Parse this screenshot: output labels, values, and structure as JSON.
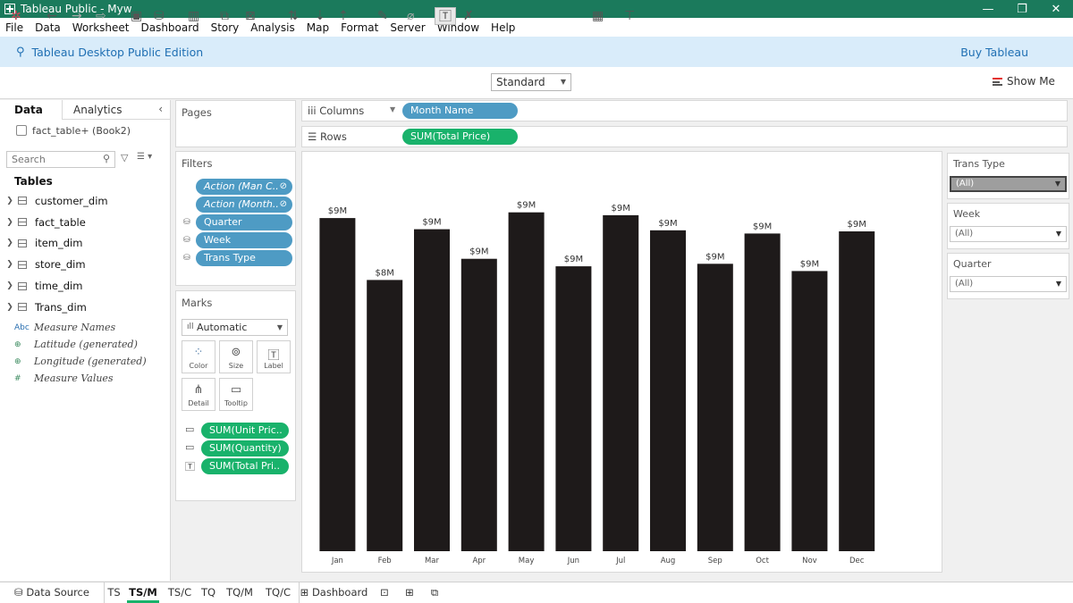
{
  "window": {
    "title": "Tableau Public - Myw",
    "controls": [
      "—",
      "❐",
      "✕"
    ]
  },
  "menu": [
    "File",
    "Data",
    "Worksheet",
    "Dashboard",
    "Story",
    "Analysis",
    "Map",
    "Format",
    "Server",
    "Window",
    "Help"
  ],
  "edition": {
    "title": "Tableau Desktop Public Edition",
    "buy": "Buy Tableau"
  },
  "toolbar": {
    "fit_select": "Standard",
    "show_me": "Show Me"
  },
  "data_pane": {
    "tabs": [
      "Data",
      "Analytics"
    ],
    "datasource": "fact_table+ (Book2)",
    "search_placeholder": "Search",
    "tables_label": "Tables",
    "tables": [
      "customer_dim",
      "fact_table",
      "item_dim",
      "store_dim",
      "time_dim",
      "Trans_dim"
    ],
    "fields": [
      {
        "icon": "Abc",
        "name": "Measure Names"
      },
      {
        "icon": "⊕",
        "name": "Latitude (generated)"
      },
      {
        "icon": "⊕",
        "name": "Longitude (generated)"
      },
      {
        "icon": "#",
        "name": "Measure Values"
      }
    ]
  },
  "pages": {
    "title": "Pages"
  },
  "filters": {
    "title": "Filters",
    "pills": [
      {
        "label": "Action (Man C..",
        "style": "italic"
      },
      {
        "label": "Action (Month..",
        "style": "italic"
      },
      {
        "label": "Quarter",
        "style": "normal"
      },
      {
        "label": "Week",
        "style": "normal"
      },
      {
        "label": "Trans Type",
        "style": "normal"
      }
    ]
  },
  "marks": {
    "title": "Marks",
    "type": "Automatic",
    "buttons": [
      "Color",
      "Size",
      "Label",
      "Detail",
      "Tooltip"
    ],
    "fields": [
      {
        "icon": "tooltip",
        "label": "SUM(Unit Pric.."
      },
      {
        "icon": "tooltip",
        "label": "SUM(Quantity)"
      },
      {
        "icon": "label",
        "label": "SUM(Total Pri.."
      }
    ]
  },
  "shelves": {
    "columns_label": "Columns",
    "columns_pill": "Month Name",
    "rows_label": "Rows",
    "rows_pill": "SUM(Total Price)"
  },
  "chart_data": {
    "type": "bar",
    "categories": [
      "Jan",
      "Feb",
      "Mar",
      "Apr",
      "May",
      "Jun",
      "Jul",
      "Aug",
      "Sep",
      "Oct",
      "Nov",
      "Dec"
    ],
    "values": [
      9.25,
      7.53,
      8.94,
      8.12,
      9.41,
      7.91,
      9.33,
      8.91,
      7.98,
      8.82,
      7.78,
      8.88
    ],
    "labels": [
      "$9M",
      "$8M",
      "$9M",
      "$9M",
      "$9M",
      "$9M",
      "$9M",
      "$9M",
      "$9M",
      "$9M",
      "$9M",
      "$9M"
    ],
    "ylim": [
      0,
      9.6
    ],
    "bar_color": "#1e1a1a",
    "grid": false
  },
  "quick_filters": [
    {
      "title": "Trans Type",
      "value": "(All)",
      "active": true
    },
    {
      "title": "Week",
      "value": "(All)",
      "active": false
    },
    {
      "title": "Quarter",
      "value": "(All)",
      "active": false
    }
  ],
  "bottom_tabs": [
    {
      "label": "Data Source",
      "active": false
    },
    {
      "label": "TS",
      "active": false
    },
    {
      "label": "TS/M",
      "active": true
    },
    {
      "label": "TS/C",
      "active": false
    },
    {
      "label": "TQ",
      "active": false
    },
    {
      "label": "TQ/M",
      "active": false
    },
    {
      "label": "TQ/C",
      "active": false
    },
    {
      "label": "Dashboard",
      "active": false
    }
  ],
  "colors": {
    "titlebar": "#1b7a5c",
    "edition_bg": "#d9ecfa",
    "pill_blue": "#4e9bc4",
    "pill_green": "#19b26b"
  }
}
